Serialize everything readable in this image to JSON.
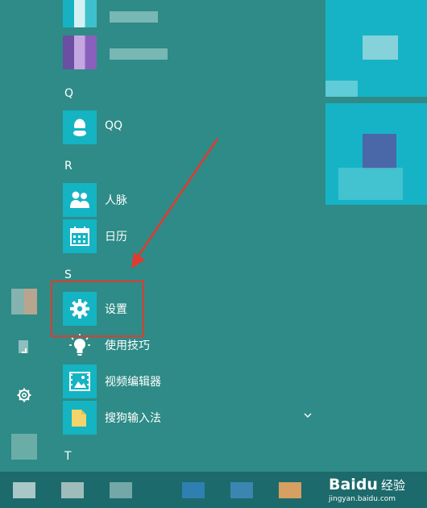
{
  "sections": {
    "q": "Q",
    "r": "R",
    "s": "S",
    "t": "T"
  },
  "apps": {
    "qq": "QQ",
    "people": "人脉",
    "calendar": "日历",
    "settings": "设置",
    "tips": "使用技巧",
    "video_editor": "视频编辑器",
    "sogou_input": "搜狗输入法"
  },
  "colors": {
    "background": "#2e8b87",
    "tile": "#14b4c3",
    "highlight": "#e23a2e",
    "taskbar": "#1c6a6c"
  },
  "icons": {
    "settings_rail": "gear-icon",
    "document_rail": "document-icon",
    "expand": "chevron-down-icon"
  },
  "watermark": {
    "logo": "Baidu",
    "label": "经验",
    "url": "jingyan.baidu.com"
  }
}
